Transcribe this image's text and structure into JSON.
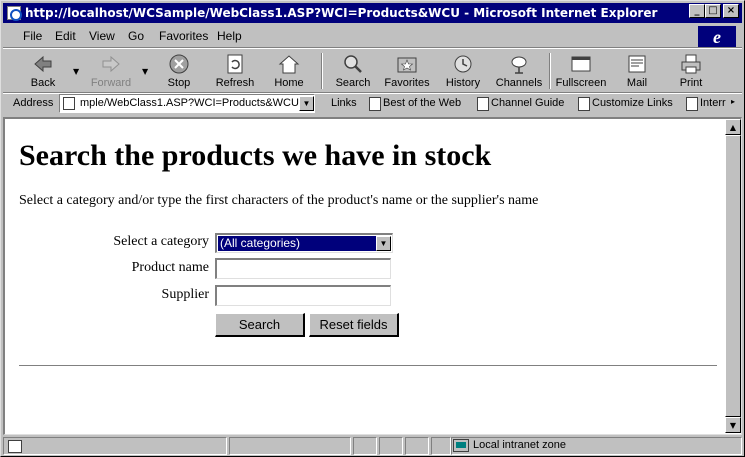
{
  "window": {
    "title": "http://localhost/WCSample/WebClass1.ASP?WCI=Products&WCU - Microsoft Internet Explorer",
    "controls": {
      "minimize": "_",
      "maximize": "□",
      "close": "×"
    }
  },
  "menubar": {
    "items": [
      "File",
      "Edit",
      "View",
      "Go",
      "Favorites",
      "Help"
    ],
    "logo": "e"
  },
  "toolbar": {
    "buttons": [
      {
        "label": "Back",
        "icon": "back-arrow-icon",
        "enabled": true
      },
      {
        "label": "Forward",
        "icon": "forward-arrow-icon",
        "enabled": false
      },
      {
        "label": "Stop",
        "icon": "stop-icon",
        "enabled": true
      },
      {
        "label": "Refresh",
        "icon": "refresh-icon",
        "enabled": true
      },
      {
        "label": "Home",
        "icon": "home-icon",
        "enabled": true
      },
      {
        "label": "Search",
        "icon": "search-icon",
        "enabled": true
      },
      {
        "label": "Favorites",
        "icon": "favorites-icon",
        "enabled": true
      },
      {
        "label": "History",
        "icon": "history-icon",
        "enabled": true
      },
      {
        "label": "Channels",
        "icon": "channels-icon",
        "enabled": true
      },
      {
        "label": "Fullscreen",
        "icon": "fullscreen-icon",
        "enabled": true
      },
      {
        "label": "Mail",
        "icon": "mail-icon",
        "enabled": true
      },
      {
        "label": "Print",
        "icon": "print-icon",
        "enabled": true
      }
    ]
  },
  "addressbar": {
    "label": "Address",
    "url": "mple/WebClass1.ASP?WCI=Products&WCU",
    "links_label": "Links",
    "links": [
      "Best of the Web",
      "Channel Guide",
      "Customize Links",
      "Interr"
    ]
  },
  "page": {
    "heading": "Search the products we have in stock",
    "intro": "Select a category and/or type the first characters of the product's name or the supplier's name",
    "form": {
      "category_label": "Select a category",
      "category_value": "(All categories)",
      "product_label": "Product name",
      "product_value": "",
      "supplier_label": "Supplier",
      "supplier_value": "",
      "search_button": "Search",
      "reset_button": "Reset fields"
    }
  },
  "statusbar": {
    "text": "",
    "zone": "Local intranet zone"
  },
  "colors": {
    "titlebar": "#00007b",
    "selection": "#00007b",
    "chrome": "#c0c0c0"
  }
}
